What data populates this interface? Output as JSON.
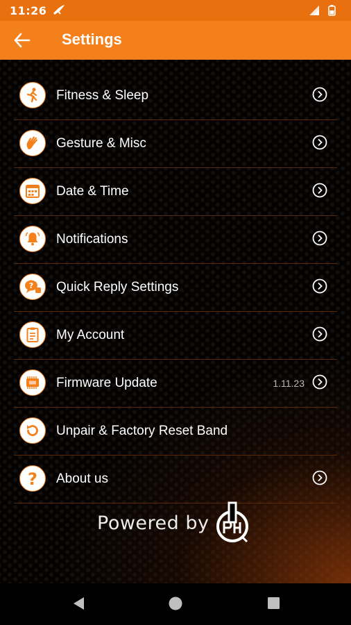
{
  "status_bar": {
    "time": "11:26"
  },
  "app_bar": {
    "title": "Settings"
  },
  "settings": [
    {
      "label": "Fitness & Sleep",
      "icon": "runner-icon"
    },
    {
      "label": "Gesture & Misc",
      "icon": "hand-wave-icon"
    },
    {
      "label": "Date & Time",
      "icon": "calendar-icon"
    },
    {
      "label": "Notifications",
      "icon": "bell-icon"
    },
    {
      "label": "Quick Reply Settings",
      "icon": "quick-reply-icon"
    },
    {
      "label": "My Account",
      "icon": "account-icon"
    },
    {
      "label": "Firmware Update",
      "icon": "chip-icon",
      "version": "1.11.23"
    },
    {
      "label": " Unpair & Factory Reset Band",
      "icon": "reset-icon"
    },
    {
      "label": "About us",
      "icon": "question-icon"
    }
  ],
  "footer": {
    "powered_by": "Powered by"
  },
  "colors": {
    "accent": "#f4801c",
    "status_bar": "#e9700f",
    "divider": "#5a2a08"
  }
}
